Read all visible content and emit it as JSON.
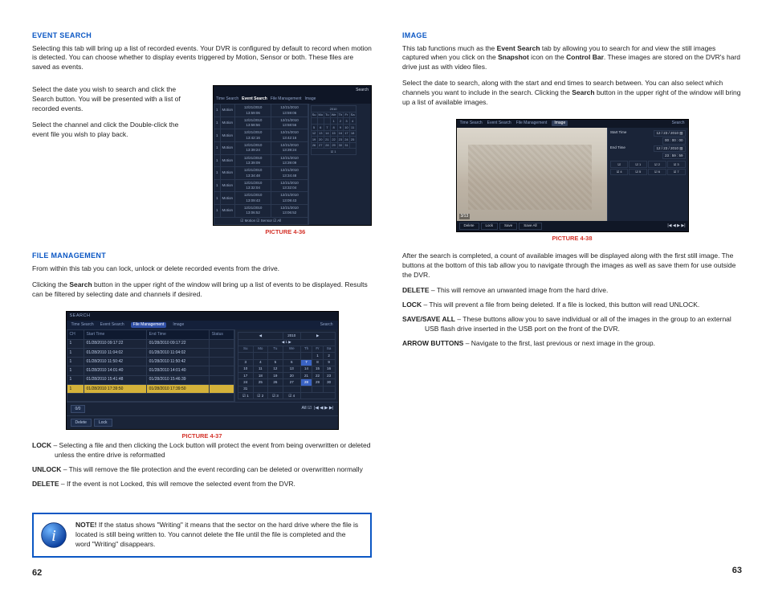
{
  "left": {
    "event_search": {
      "title": "EVENT SEARCH",
      "p1": "Selecting this tab will bring up a list of recorded events. Your DVR is configured by default to record when motion is detected. You can choose whether to display events triggered by Motion, Sensor or both. These files are saved as events.",
      "p2": "Select the date you wish to search and click the Search button. You will be presented with a list of recorded events.",
      "p3": "Select the channel and click the Double-click the event file you wish to play back."
    },
    "pic36": {
      "tabs": [
        "Time Search",
        "Event Search",
        "File Management",
        "Image"
      ],
      "search": "Search",
      "year_nav": "2010",
      "dow": [
        "Su",
        "Mo",
        "Tu",
        "We",
        "Th",
        "Fr",
        "Sa"
      ],
      "rows": [
        [
          "1",
          "Motion",
          "12/21/2010 13:59:06",
          "12/21/2010 13:59:06"
        ],
        [
          "1",
          "Motion",
          "12/21/2010 13:58:56",
          "12/21/2010 13:58:56"
        ],
        [
          "1",
          "Motion",
          "12/21/2010 13:42:16",
          "12/21/2010 13:42:16"
        ],
        [
          "1",
          "Motion",
          "12/21/2010 13:39:24",
          "12/21/2010 13:39:24"
        ],
        [
          "1",
          "Motion",
          "12/21/2010 13:39:09",
          "12/21/2010 13:39:09"
        ],
        [
          "1",
          "Motion",
          "12/21/2010 13:34:48",
          "12/21/2010 13:34:48"
        ],
        [
          "1",
          "Motion",
          "12/21/2010 13:32:04",
          "12/21/2010 13:32:04"
        ],
        [
          "1",
          "Motion",
          "12/21/2010 13:09:43",
          "12/21/2010 13:09:43"
        ],
        [
          "1",
          "Motion",
          "12/21/2010 13:06:52",
          "12/21/2010 13:06:52"
        ]
      ],
      "chk_row": [
        "☑ 1",
        "☑ 2",
        "☑ 3",
        "☑ 4"
      ],
      "filter": "☑ Motion  ☑ Sensor  ☑ All",
      "caption": "PICTURE 4-36"
    },
    "file_mgmt": {
      "title": "FILE MANAGEMENT",
      "p1": "From within this tab you can lock, unlock or delete recorded events from the drive.",
      "p2": "Clicking the Search button in the upper right of the window will bring up a list of events to be displayed. Results can be filtered by selecting date and channels if desired."
    },
    "pic37": {
      "hdr": "SEARCH",
      "tabs": [
        "Time Search",
        "Event Search",
        "File Management",
        "Image"
      ],
      "search": "Search",
      "cols": [
        "CH",
        "Start Time",
        "End Time",
        "Status"
      ],
      "rows": [
        [
          "1",
          "01/28/2010  09:17:22",
          "01/28/2010  09:17:22",
          ""
        ],
        [
          "1",
          "01/28/2010  11:04:02",
          "01/28/2010  11:04:02",
          ""
        ],
        [
          "1",
          "01/28/2010  11:50:42",
          "01/28/2010  11:50:42",
          ""
        ],
        [
          "1",
          "01/28/2010  14:01:40",
          "01/28/2010  14:01:40",
          ""
        ],
        [
          "1",
          "01/28/2010  15:41:48",
          "01/28/2010  15:46:39",
          ""
        ],
        [
          "1",
          "01/28/2010  17:39:50",
          "01/28/2010  17:39:50",
          ""
        ]
      ],
      "dow": [
        "Su",
        "Mo",
        "Tu",
        "We",
        "Th",
        "Fr",
        "Sa"
      ],
      "year": "2010",
      "month_nav": "◀   1   ▶",
      "cal_rows": [
        [
          "",
          "",
          "",
          "",
          "",
          "1",
          "2"
        ],
        [
          "3",
          "4",
          "5",
          "6",
          "7",
          "8",
          "9"
        ],
        [
          "10",
          "11",
          "12",
          "13",
          "14",
          "15",
          "16"
        ],
        [
          "17",
          "18",
          "19",
          "20",
          "21",
          "22",
          "23"
        ],
        [
          "24",
          "25",
          "26",
          "27",
          "28",
          "29",
          "30"
        ],
        [
          "31",
          "",
          "",
          "",
          "",
          "",
          ""
        ]
      ],
      "chk": [
        "☑ 1",
        "☑ 2",
        "☑ 3",
        "☑ 4"
      ],
      "foot_all": "All ☑",
      "foot_nav": "|◀  ◀  ▶  ▶|",
      "foot_page": "0/0",
      "btn_delete": "Delete",
      "btn_lock": "Lock",
      "caption": "PICTURE 4-37"
    },
    "lock_desc": {
      "lock_t": "LOCK",
      "lock": " – Selecting a file and then clicking the Lock button will protect the event from being overwritten or deleted unless the entire drive is reformatted",
      "unlock_t": "UNLOCK",
      "unlock": " – This will remove the file protection and the event recording can be deleted or overwritten normally",
      "delete_t": "DELETE",
      "delete": " – If the event is not Locked, this will remove the selected event from the DVR."
    },
    "note": {
      "prefix": "NOTE!",
      "body": " If the status shows \"Writing\" it means that the sector on the hard drive where the file is located is still being written to. You cannot delete the file until the file is completed and the word \"Writing\" disappears."
    },
    "pagenum": "62"
  },
  "right": {
    "image": {
      "title": "IMAGE",
      "p1a": "This tab functions much as the ",
      "p1b": "Event Search",
      "p1c": " tab by allowing you to search for and view the still images captured when you click on the ",
      "p1d": "Snapshot",
      "p1e": " icon on the ",
      "p1f": "Control Bar",
      "p1g": ". These images are stored on the DVR's hard drive just as with video files.",
      "p2a": "Select the date to search, along with the start and end times to search between. You can also select which channels you want to include in the search. Clicking the ",
      "p2b": "Search",
      "p2c": " button in the upper right of the window will bring up a list of available images."
    },
    "pic38": {
      "tabs": [
        "Time Search",
        "Event Search",
        "File Management",
        "Image"
      ],
      "search": "Search",
      "start_lbl": "Start Time",
      "end_lbl": "End Time",
      "date1": "12 / 23 / 2010 ▧",
      "time1": "00   :   00   :   00",
      "date2": "12 / 23 / 2010 ▧",
      "time2": "23   :   59   :   59",
      "chk": [
        "☑",
        "☑ 1",
        "☑ 2",
        "☑ 3",
        "☑ 4"
      ],
      "chk2": [
        "",
        "☑ 5",
        "☑ 6",
        "☑ 7",
        "☑ 8"
      ],
      "counter": "3/13",
      "btn_delete": "Delete",
      "btn_lock": "Lock",
      "btn_save": "Save",
      "btn_saveall": "Save All",
      "nav": "|◀   ◀   ▶   ▶|",
      "caption": "PICTURE 4-38"
    },
    "after": "After the search is completed, a count of available images will be displayed along with the first still image. The buttons at the bottom of this tab allow you to navigate through the images as well as save them for use outside the DVR.",
    "defs": {
      "delete_t": "DELETE",
      "delete": " – This will remove an unwanted image from the hard drive.",
      "lock_t": "LOCK",
      "lock": " – This will prevent a file from being deleted. If a file is locked, this button will read UNLOCK.",
      "save_t": "SAVE/SAVE ALL",
      "save": " – These buttons allow you to save individual or all of the images in the group to an external USB flash drive inserted in the USB port on the front of the DVR.",
      "arrow_t": "ARROW BUTTONS",
      "arrow": " – Navigate to the first, last previous or next image in the group."
    },
    "pagenum": "63"
  }
}
